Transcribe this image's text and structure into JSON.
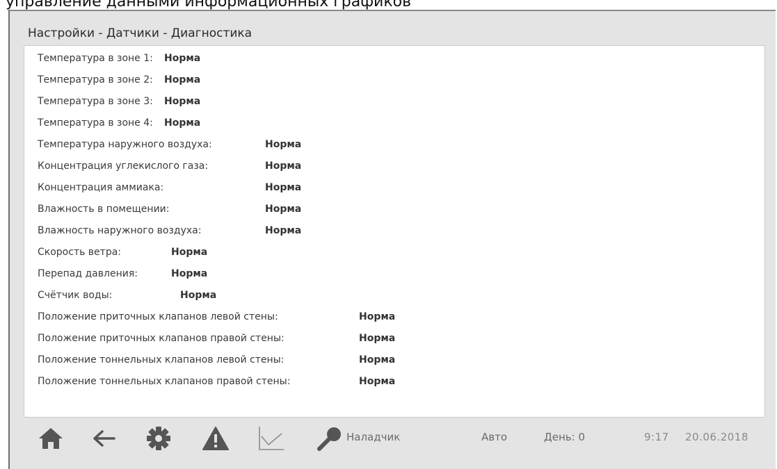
{
  "top_fragment": "управление данными информационных графиков",
  "title": "Настройки - Датчики - Диагностика",
  "sensors": [
    {
      "label": "Температура в зоне 1:",
      "status": "Норма"
    },
    {
      "label": "Температура в зоне 2:",
      "status": "Норма"
    },
    {
      "label": "Температура в зоне 3:",
      "status": "Норма"
    },
    {
      "label": "Температура в зоне 4:",
      "status": "Норма"
    },
    {
      "label": "Температура наружного воздуха:",
      "status": "Норма"
    },
    {
      "label": "Концентрация углекислого газа:",
      "status": "Норма"
    },
    {
      "label": "Концентрация аммиака:",
      "status": "Норма"
    },
    {
      "label": "Влажность в помещении:",
      "status": "Норма"
    },
    {
      "label": "Влажность наружного воздуха:",
      "status": "Норма"
    },
    {
      "label": "Скорость ветра:",
      "status": "Норма"
    },
    {
      "label": "Перепад давления:",
      "status": "Норма"
    },
    {
      "label": "Счётчик воды:",
      "status": "Норма"
    },
    {
      "label": "Положение приточных клапанов левой стены:",
      "status": "Норма"
    },
    {
      "label": "Положение приточных клапанов правой стены:",
      "status": "Норма"
    },
    {
      "label": "Положение тоннельных клапанов левой стены:",
      "status": "Норма"
    },
    {
      "label": "Положение тоннельных клапанов правой стены:",
      "status": "Норма"
    }
  ],
  "statusbar": {
    "icons": [
      "home-icon",
      "back-arrow-icon",
      "gear-icon",
      "warning-icon",
      "chart-icon",
      "key-icon"
    ],
    "user": "Наладчик",
    "mode": "Авто",
    "day": "День: 0",
    "time": "9:17",
    "date": "20.06.2018"
  },
  "colors": {
    "frame_bg": "#e4e4e4",
    "panel_bg": "#ffffff",
    "icon_dark": "#555555",
    "icon_light": "#8a8a8a"
  }
}
